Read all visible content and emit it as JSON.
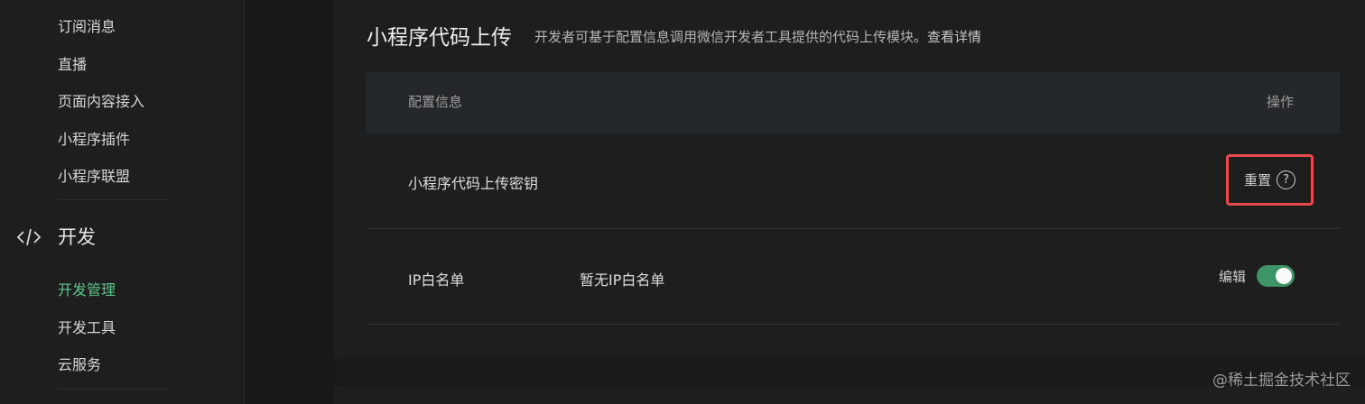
{
  "sidebar": {
    "items_top": [
      "订阅消息",
      "直播",
      "页面内容接入",
      "小程序插件",
      "小程序联盟"
    ],
    "dev_group": {
      "icon": "code-icon",
      "title": "开发"
    },
    "items_dev": [
      "开发管理",
      "开发工具",
      "云服务"
    ],
    "active_item": "开发管理"
  },
  "section": {
    "title": "小程序代码上传",
    "desc": "开发者可基于配置信息调用微信开发者工具提供的代码上传模块。",
    "desc_link": "查看详情"
  },
  "table": {
    "headers": {
      "config": "配置信息",
      "action": "操作"
    },
    "rows": [
      {
        "name": "小程序代码上传密钥",
        "value": "",
        "action": "重置",
        "action_icon": "help-icon"
      },
      {
        "name": "IP白名单",
        "value": "暂无IP白名单",
        "action": "编辑",
        "toggle": "on"
      }
    ]
  },
  "watermark": "@稀土掘金技术社区",
  "colors": {
    "accent": "#5cc78a",
    "toggle_on": "#3d9466",
    "highlight_box": "#e84b4b"
  }
}
